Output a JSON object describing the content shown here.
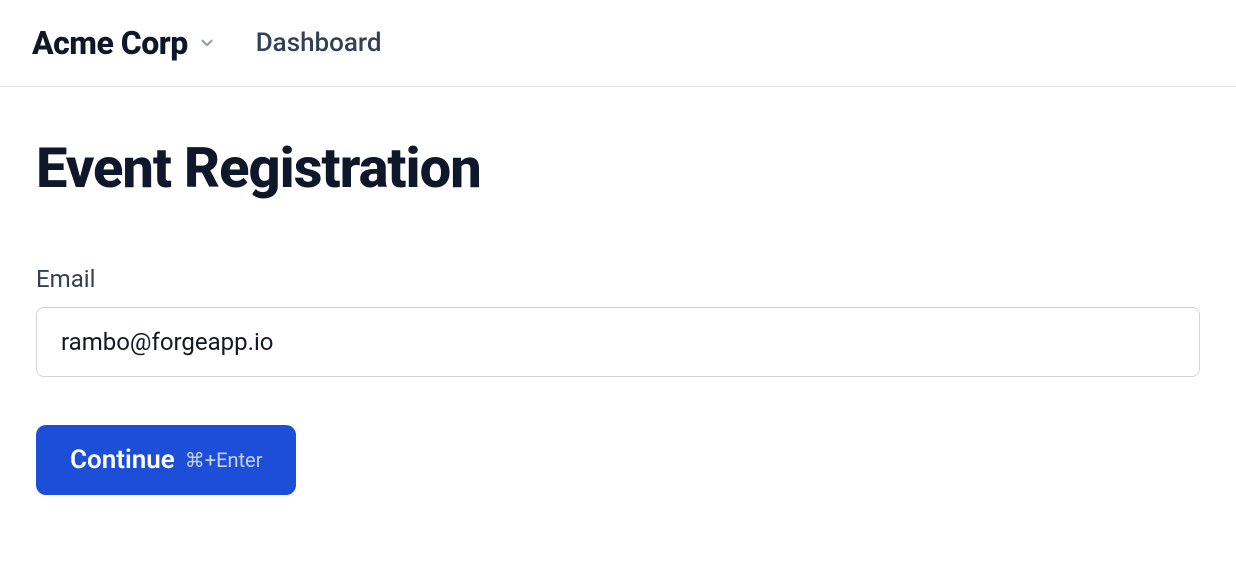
{
  "header": {
    "org_name": "Acme Corp",
    "nav_item": "Dashboard"
  },
  "page": {
    "title": "Event Registration"
  },
  "form": {
    "email_label": "Email",
    "email_value": "rambo@forgeapp.io",
    "submit_label": "Continue",
    "submit_hint": "⌘+Enter"
  }
}
